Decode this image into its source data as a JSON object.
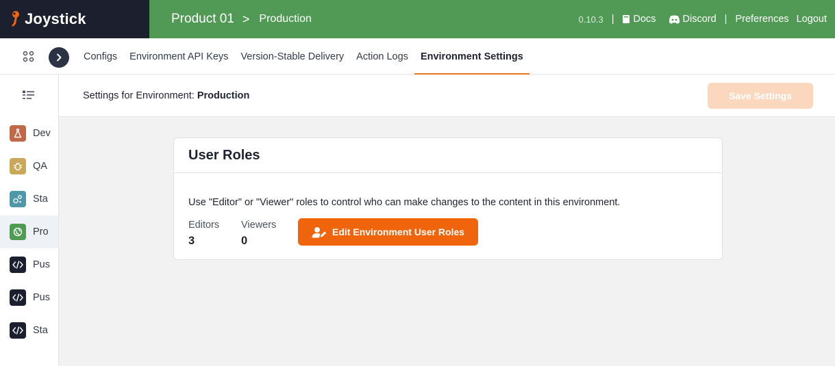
{
  "brand": {
    "name": "Joystick"
  },
  "breadcrumb": {
    "product": "Product 01",
    "separator": ">",
    "environment": "Production"
  },
  "header_links": {
    "version": "0.10.3",
    "separator": "|",
    "docs": "Docs",
    "discord": "Discord",
    "preferences": "Preferences",
    "logout": "Logout"
  },
  "tabs": [
    {
      "label": "Configs",
      "active": false
    },
    {
      "label": "Environment API Keys",
      "active": false
    },
    {
      "label": "Version-Stable Delivery",
      "active": false
    },
    {
      "label": "Action Logs",
      "active": false
    },
    {
      "label": "Environment Settings",
      "active": true
    }
  ],
  "sidebar": {
    "items": [
      {
        "label": "Dev",
        "icon": "flask-icon",
        "color": "#c0694a",
        "active": false
      },
      {
        "label": "QA",
        "icon": "bug-icon",
        "color": "#c9a85a",
        "active": false
      },
      {
        "label": "Sta",
        "icon": "bubbles-icon",
        "color": "#4e98a8",
        "active": false
      },
      {
        "label": "Pro",
        "icon": "globe-icon",
        "color": "#4f9b53",
        "active": true
      },
      {
        "label": "Pus",
        "icon": "code-icon",
        "color": "#1b1f2e",
        "active": false
      },
      {
        "label": "Pus",
        "icon": "code-icon",
        "color": "#1b1f2e",
        "active": false
      },
      {
        "label": "Sta",
        "icon": "code-icon",
        "color": "#1b1f2e",
        "active": false
      }
    ]
  },
  "settings": {
    "title_prefix": "Settings for Environment: ",
    "environment": "Production",
    "save_label": "Save Settings"
  },
  "card": {
    "title": "User Roles",
    "description": "Use \"Editor\" or \"Viewer\" roles to control who can make changes to the content in this environment.",
    "editors_label": "Editors",
    "editors_count": "3",
    "viewers_label": "Viewers",
    "viewers_count": "0",
    "edit_button_label": "Edit Environment User Roles"
  },
  "colors": {
    "brand_dark": "#1b1f2e",
    "header_green": "#519a55",
    "accent_orange": "#f0640c",
    "save_disabled": "#fbd8bd"
  }
}
